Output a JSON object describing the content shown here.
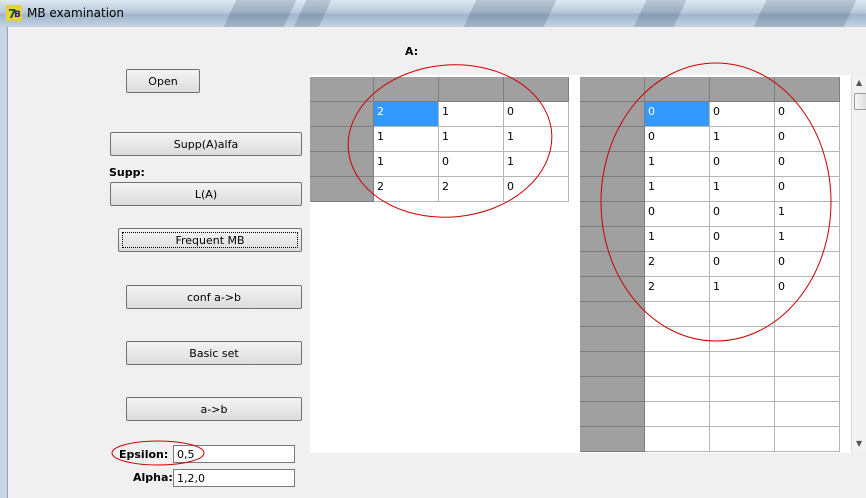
{
  "window": {
    "title": "MB examination",
    "icon": "app-icon"
  },
  "buttons": {
    "open": "Open",
    "supp_alfa": "Supp(A)alfa",
    "la": "L(A)",
    "frequent_mb": "Frequent MB",
    "conf": "conf a->b",
    "basic_set": "Basic set",
    "ab": "a->b"
  },
  "labels": {
    "a": "A:",
    "supp": "Supp:",
    "epsilon": "Epsilon:",
    "alpha": "Alpha:"
  },
  "inputs": {
    "epsilon": "0,5",
    "alpha": "1,2,0"
  },
  "grid_left": {
    "rows": [
      [
        "2",
        "1",
        "0"
      ],
      [
        "1",
        "1",
        "1"
      ],
      [
        "1",
        "0",
        "1"
      ],
      [
        "2",
        "2",
        "0"
      ]
    ],
    "selected": [
      0,
      0
    ]
  },
  "grid_right": {
    "rows": [
      [
        "0",
        "0",
        "0"
      ],
      [
        "0",
        "1",
        "0"
      ],
      [
        "1",
        "0",
        "0"
      ],
      [
        "1",
        "1",
        "0"
      ],
      [
        "0",
        "0",
        "1"
      ],
      [
        "1",
        "0",
        "1"
      ],
      [
        "2",
        "0",
        "0"
      ],
      [
        "2",
        "1",
        "0"
      ],
      [
        "",
        "",
        ""
      ],
      [
        "",
        "",
        ""
      ],
      [
        "",
        "",
        ""
      ],
      [
        "",
        "",
        ""
      ],
      [
        "",
        "",
        ""
      ],
      [
        "",
        "",
        ""
      ]
    ],
    "selected": [
      0,
      0
    ]
  },
  "colors": {
    "selection": "#3399ff",
    "annotation": "#cc0000",
    "header": "#a0a0a0"
  }
}
